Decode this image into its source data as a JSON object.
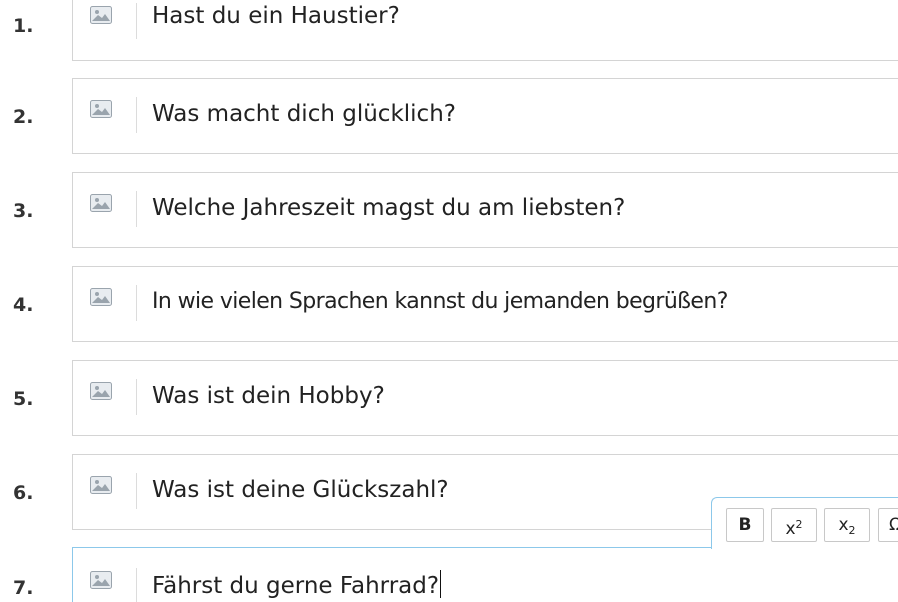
{
  "questions": [
    {
      "number": "1.",
      "text": "Hast du ein Haustier?"
    },
    {
      "number": "2.",
      "text": "Was macht dich glücklich?"
    },
    {
      "number": "3.",
      "text": "Welche Jahreszeit magst du am liebsten?"
    },
    {
      "number": "4.",
      "text": "In wie vielen Sprachen kannst du jemanden begrüßen?"
    },
    {
      "number": "5.",
      "text": "Was ist dein Hobby?"
    },
    {
      "number": "6.",
      "text": "Was ist deine Glückszahl?"
    },
    {
      "number": "7.",
      "text": "Fährst du gerne Fahrrad?"
    }
  ],
  "toolbar": {
    "bold_label": "B",
    "superscript_base": "x",
    "superscript_mark": "2",
    "subscript_base": "x",
    "subscript_mark": "2",
    "clipped_label": "Ω"
  },
  "icons": {
    "image_button": "image-icon"
  },
  "colors": {
    "active_border": "#8cc8ea",
    "box_border": "#d4d4d4"
  }
}
